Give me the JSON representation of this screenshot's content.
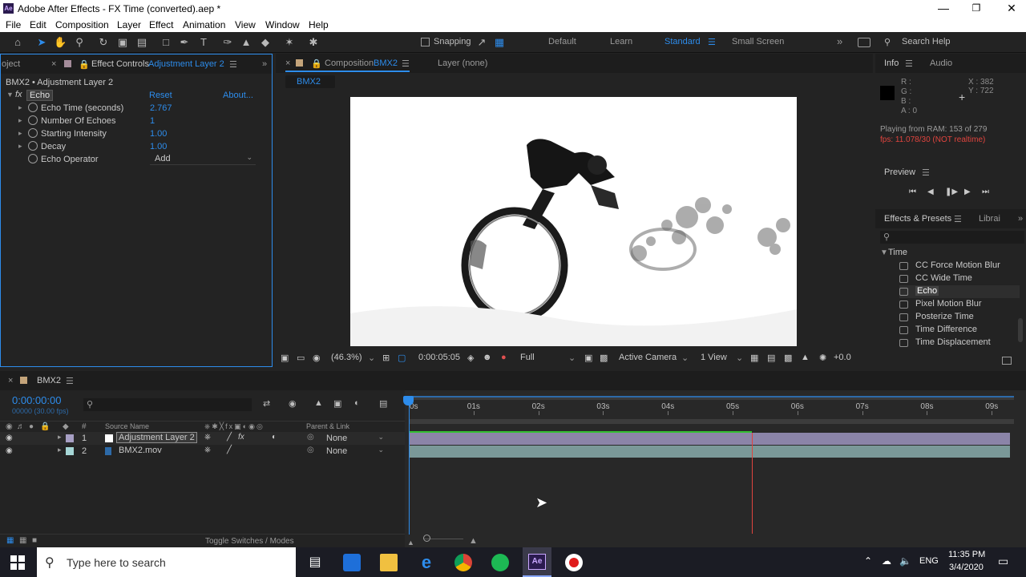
{
  "window": {
    "title": "Adobe After Effects - FX Time (converted).aep *",
    "app_badge": "Ae",
    "controls": [
      "minimize-icon",
      "restore-icon",
      "close-icon"
    ]
  },
  "menu": [
    "File",
    "Edit",
    "Composition",
    "Layer",
    "Effect",
    "Animation",
    "View",
    "Window",
    "Help"
  ],
  "toolbar": {
    "snapping_label": "Snapping",
    "workspaces": [
      "Default",
      "Learn",
      "Standard",
      "Small Screen"
    ],
    "active_workspace": "Standard",
    "search_help": "Search Help"
  },
  "effect_controls": {
    "project_tab": "oject",
    "tab_label": "Effect Controls",
    "tab_layer": "Adjustment Layer 2",
    "subtitle": "BMX2 • Adjustment Layer 2",
    "effect_badge": "fx",
    "effect_name": "Echo",
    "reset_label": "Reset",
    "about_label": "About...",
    "params": [
      {
        "label": "Echo Time (seconds)",
        "value": "2.767"
      },
      {
        "label": "Number Of Echoes",
        "value": "1"
      },
      {
        "label": "Starting Intensity",
        "value": "1.00"
      },
      {
        "label": "Decay",
        "value": "1.00"
      }
    ],
    "operator_label": "Echo Operator",
    "operator_value": "Add"
  },
  "composition": {
    "tab_label": "Composition",
    "tab_name": "BMX2",
    "layer_tab": "Layer (none)",
    "breadcrumb": "BMX2",
    "zoom": "(46.3%)",
    "timecode": "0:00:05:05",
    "resolution": "Full",
    "camera": "Active Camera",
    "views": "1 View",
    "exposure": "+0.0"
  },
  "info": {
    "tab": "Info",
    "audio_tab": "Audio",
    "r": "R :",
    "g": "G :",
    "b": "B :",
    "a": "A : 0",
    "x": "X : 382",
    "y": "Y : 722",
    "playing": "Playing from RAM: 153 of 279",
    "fps": "fps: 11.078/30 (NOT realtime)"
  },
  "preview": {
    "tab": "Preview"
  },
  "effects_presets": {
    "tab": "Effects & Presets",
    "libraries_tab": "Librai",
    "category": "Time",
    "items": [
      "CC Force Motion Blur",
      "CC Wide Time",
      "Echo",
      "Pixel Motion Blur",
      "Posterize Time",
      "Time Difference",
      "Time Displacement"
    ],
    "selected": "Echo"
  },
  "timeline": {
    "tab": "BMX2",
    "current_time": "0:00:00:00",
    "frame_info": "00000 (30.00 fps)",
    "col_source": "Source Name",
    "col_parent": "Parent & Link",
    "ruler": [
      "0s",
      "01s",
      "02s",
      "03s",
      "04s",
      "05s",
      "06s",
      "07s",
      "08s",
      "09s"
    ],
    "layers": [
      {
        "num": "1",
        "name": "Adjustment Layer 2",
        "parent": "None",
        "color": "#ffffff"
      },
      {
        "num": "2",
        "name": "BMX2.mov",
        "parent": "None",
        "color": "#a6d6d6"
      }
    ],
    "toggle": "Toggle Switches / Modes",
    "playhead_seconds": 0,
    "cache_end_seconds": 5.3
  },
  "taskbar": {
    "search_placeholder": "Type here to search",
    "time": "11:35 PM",
    "date": "3/4/2020",
    "lang": "ENG"
  }
}
